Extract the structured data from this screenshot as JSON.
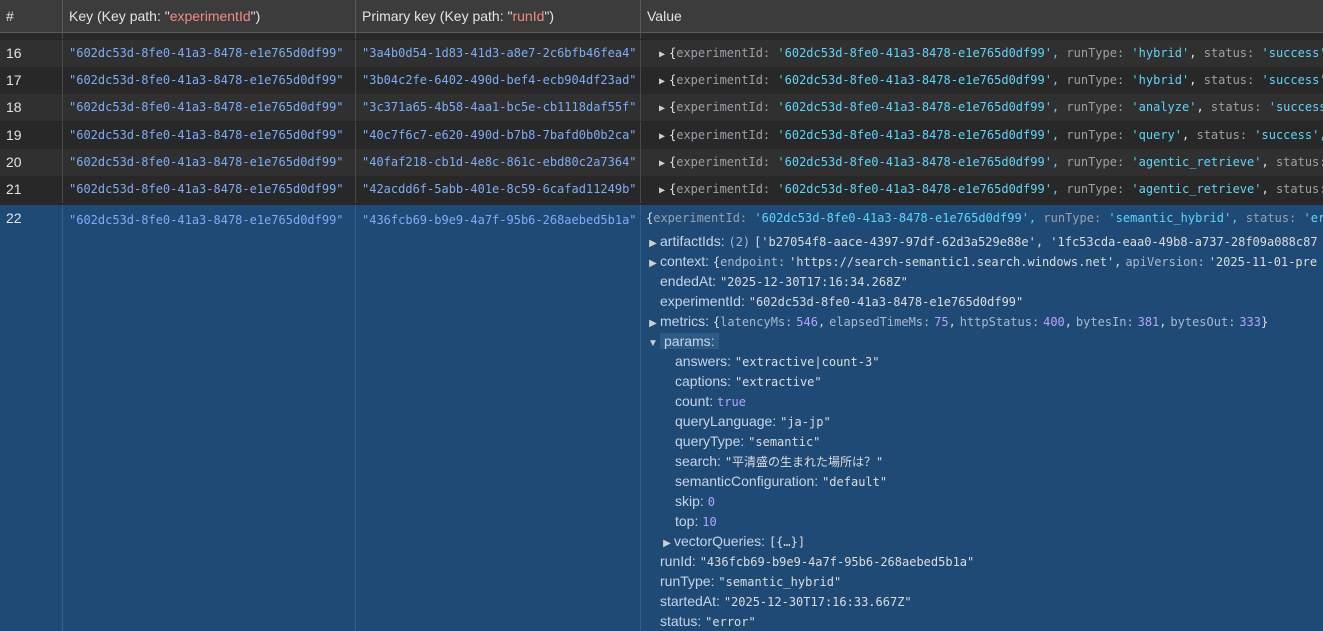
{
  "header": {
    "col_index": "#",
    "col_key_prefix": "Key (Key path: \"",
    "col_key_path": "experimentId",
    "col_key_suffix": "\")",
    "col_pk_prefix": "Primary key (Key path: \"",
    "col_pk_path": "runId",
    "col_pk_suffix": "\")",
    "col_value": "Value"
  },
  "rows": [
    {
      "index": "16",
      "key": "\"602dc53d-8fe0-41a3-8478-e1e765d0df99\"",
      "pk": "\"3a4b0d54-1d83-41d3-a8e7-2c6bfb46fea4\"",
      "runType": "'hybrid'",
      "status_key": "status:",
      "status_val": "'success',"
    },
    {
      "index": "17",
      "key": "\"602dc53d-8fe0-41a3-8478-e1e765d0df99\"",
      "pk": "\"3b04c2fe-6402-490d-bef4-ecb904df23ad\"",
      "runType": "'hybrid'",
      "status_key": "status:",
      "status_val": "'success',"
    },
    {
      "index": "18",
      "key": "\"602dc53d-8fe0-41a3-8478-e1e765d0df99\"",
      "pk": "\"3c371a65-4b58-4aa1-bc5e-cb1118daf55f\"",
      "runType": "'analyze'",
      "status_key": "status:",
      "status_val": "'success',"
    },
    {
      "index": "19",
      "key": "\"602dc53d-8fe0-41a3-8478-e1e765d0df99\"",
      "pk": "\"40c7f6c7-e620-490d-b7b8-7bafd0b0b2ca\"",
      "runType": "'query'",
      "status_key": "status:",
      "status_val": "'success',"
    },
    {
      "index": "20",
      "key": "\"602dc53d-8fe0-41a3-8478-e1e765d0df99\"",
      "pk": "\"40faf218-cb1d-4e8c-861c-ebd80c2a7364\"",
      "runType": "'agentic_retrieve'",
      "status_key": "status:",
      "status_val": "'"
    },
    {
      "index": "21",
      "key": "\"602dc53d-8fe0-41a3-8478-e1e765d0df99\"",
      "pk": "\"42acdd6f-5abb-401e-8c59-6cafad11249b\"",
      "runType": "'agentic_retrieve'",
      "status_key": "status:",
      "status_val": "'"
    }
  ],
  "summary": {
    "experimentId_key": "experimentId:",
    "experimentId_val": "'602dc53d-8fe0-41a3-8478-e1e765d0df99',",
    "runType_key": "runType:"
  },
  "selected": {
    "index": "22",
    "key": "\"602dc53d-8fe0-41a3-8478-e1e765d0df99\"",
    "pk": "\"436fcb69-b9e9-4a7f-95b6-268aebed5b1a\"",
    "summary_open": "{",
    "summary_eid_key": "experimentId:",
    "summary_eid_val": "'602dc53d-8fe0-41a3-8478-e1e765d0df99',",
    "summary_rt_key": "runType:",
    "summary_rt_val": "'semantic_hybrid',",
    "summary_st_key": "status:",
    "summary_st_val": "'erro",
    "artifactIds_key": "artifactIds",
    "artifactIds_count": "(2)",
    "artifactIds_val": "['b27054f8-aace-4397-97df-62d3a529e88e', '1fc53cda-eaa0-49b8-a737-28f09a088c87",
    "context_key": "context",
    "context_ep_key": "endpoint:",
    "context_ep_val": "'https://search-semantic1.search.windows.net',",
    "context_api_key": "apiVersion:",
    "context_api_val": "'2025-11-01-pre",
    "endedAt_key": "endedAt",
    "endedAt_val": "\"2025-12-30T17:16:34.268Z\"",
    "experimentId_key": "experimentId",
    "experimentId_val": "\"602dc53d-8fe0-41a3-8478-e1e765d0df99\"",
    "metrics_key": "metrics",
    "m_latency_key": "latencyMs:",
    "m_latency_val": "546",
    "m_elapsed_key": "elapsedTimeMs:",
    "m_elapsed_val": "75",
    "m_http_key": "httpStatus:",
    "m_http_val": "400",
    "m_in_key": "bytesIn:",
    "m_in_val": "381",
    "m_out_key": "bytesOut:",
    "m_out_val": "333",
    "params_key": "params",
    "params": [
      {
        "k": "answers",
        "v": "\"extractive|count-3\"",
        "t": "s"
      },
      {
        "k": "captions",
        "v": "\"extractive\"",
        "t": "s"
      },
      {
        "k": "count",
        "v": "true",
        "t": "n"
      },
      {
        "k": "queryLanguage",
        "v": "\"ja-jp\"",
        "t": "s"
      },
      {
        "k": "queryType",
        "v": "\"semantic\"",
        "t": "s"
      },
      {
        "k": "search",
        "v": "\"平清盛の生まれた場所は？\"",
        "t": "s"
      },
      {
        "k": "semanticConfiguration",
        "v": "\"default\"",
        "t": "s"
      },
      {
        "k": "skip",
        "v": "0",
        "t": "n"
      },
      {
        "k": "top",
        "v": "10",
        "t": "n"
      }
    ],
    "vectorQueries_key": "vectorQueries",
    "vectorQueries_val": "[{…}]",
    "runId_key": "runId",
    "runId_val": "\"436fcb69-b9e9-4a7f-95b6-268aebed5b1a\"",
    "runType_key": "runType",
    "runType_val": "\"semantic_hybrid\"",
    "startedAt_key": "startedAt",
    "startedAt_val": "\"2025-12-30T17:16:33.667Z\"",
    "status_key": "status",
    "status_val": "\"error\""
  }
}
